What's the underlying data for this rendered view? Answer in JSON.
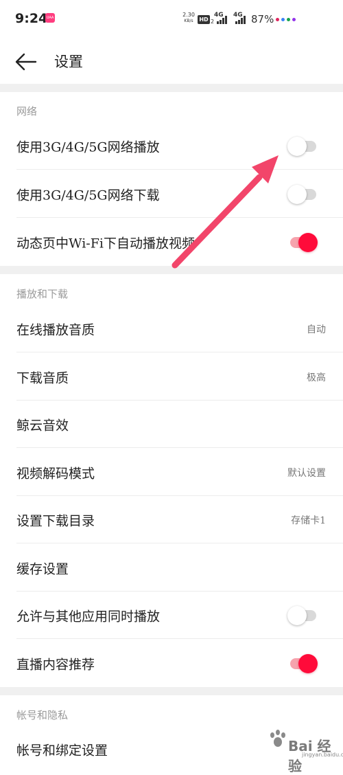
{
  "status_bar": {
    "time": "9:24",
    "app_badge": "UAA",
    "speed_value": "2.30",
    "speed_unit": "KB/s",
    "hd_label": "HD",
    "hd_sub": "2",
    "net1": "4G",
    "net2": "4G",
    "battery": "87%",
    "dot_colors": [
      "#e0245e",
      "#3b82f6",
      "#16a34a",
      "#9333ea"
    ]
  },
  "header": {
    "title": "设置"
  },
  "sections": {
    "network": {
      "title": "网络",
      "items": [
        {
          "label": "使用3G/4G/5G网络播放",
          "enabled": false
        },
        {
          "label": "使用3G/4G/5G网络下载",
          "enabled": false
        },
        {
          "label": "动态页中Wi-Fi下自动播放视频",
          "enabled": true
        }
      ]
    },
    "playback": {
      "title": "播放和下载",
      "items": [
        {
          "label": "在线播放音质",
          "value": "自动"
        },
        {
          "label": "下载音质",
          "value": "极高"
        },
        {
          "label": "鲸云音效",
          "value": ""
        },
        {
          "label": "视频解码模式",
          "value": "默认设置"
        },
        {
          "label": "设置下载目录",
          "value": "存储卡1"
        },
        {
          "label": "缓存设置",
          "value": ""
        },
        {
          "label": "允许与其他应用同时播放",
          "enabled": false
        },
        {
          "label": "直播内容推荐",
          "enabled": true
        }
      ]
    },
    "account": {
      "title": "帐号和隐私",
      "items": [
        {
          "label": "帐号和绑定设置"
        }
      ]
    }
  },
  "colors": {
    "toggle_on": "#ff0b3a",
    "toggle_on_track": "#f6a3ad",
    "toggle_off_track": "#d9d9d9",
    "annotation_arrow": "#f2456a"
  },
  "watermark": {
    "text": "Bai 经验",
    "sub": "jingyan.baidu.com"
  }
}
